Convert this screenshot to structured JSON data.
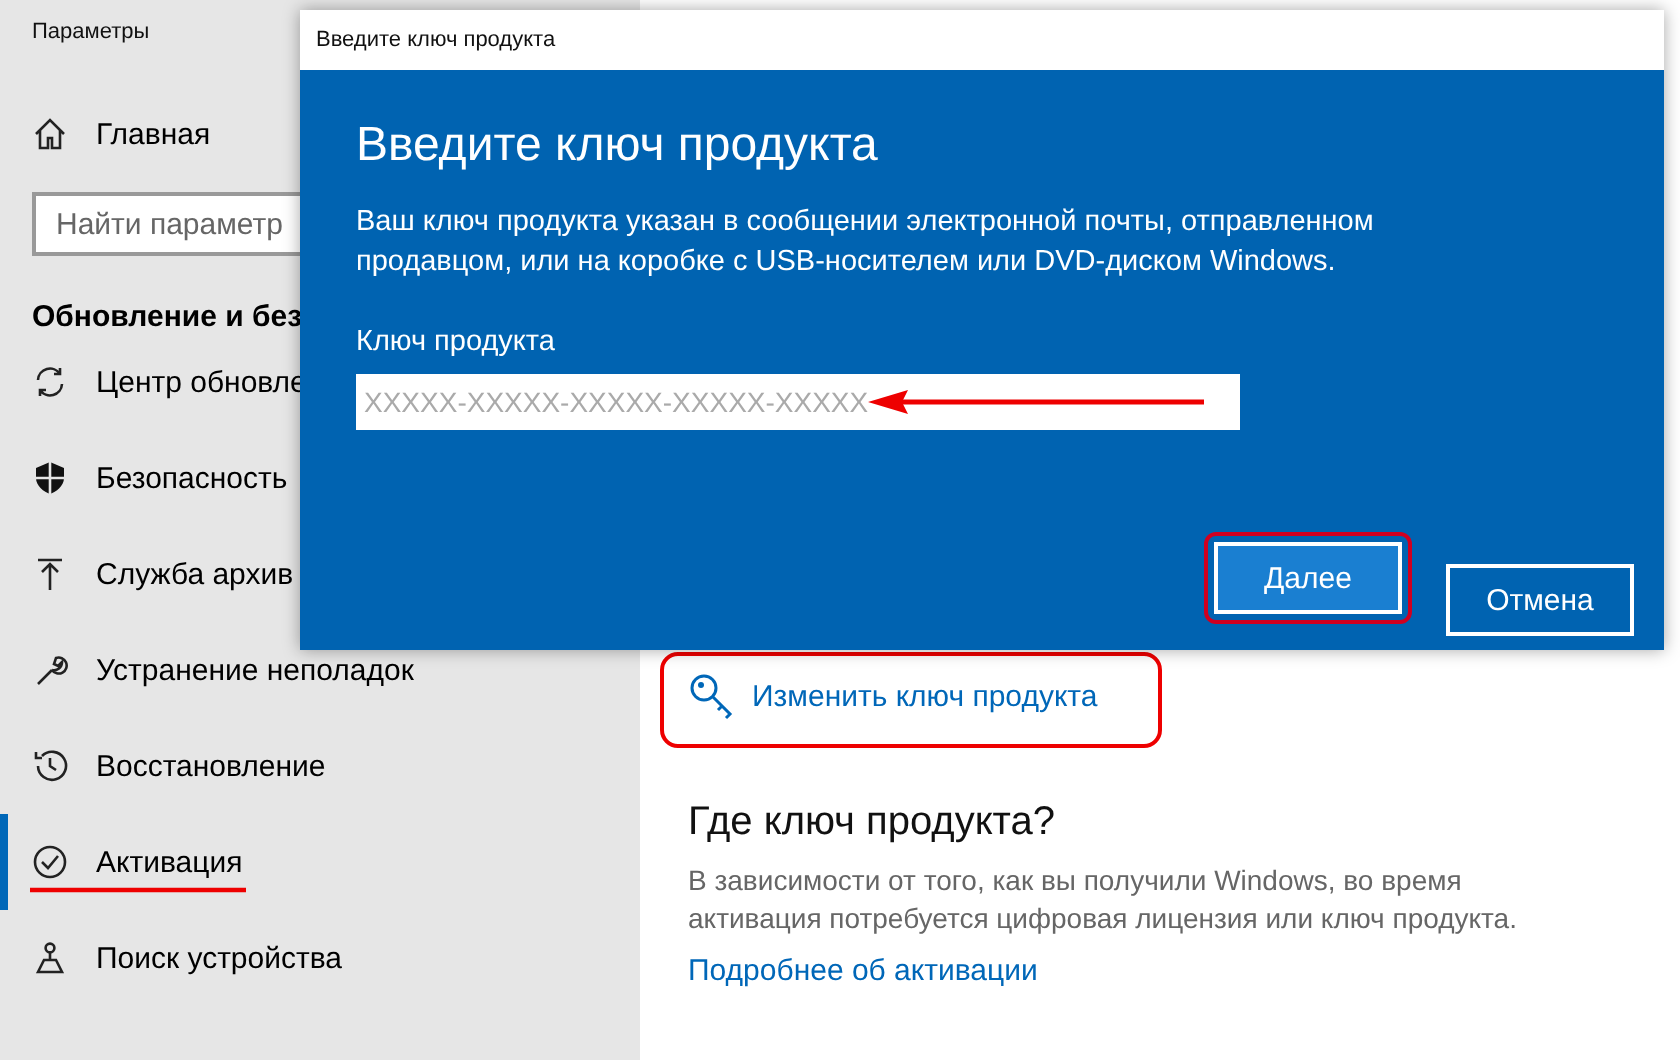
{
  "window": {
    "title": "Параметры"
  },
  "home": {
    "label": "Главная"
  },
  "search": {
    "placeholder": "Найти параметр"
  },
  "section_title": "Обновление и без",
  "sidebar": {
    "items": [
      {
        "kind": "sync",
        "label": "Центр обновле",
        "selected": false
      },
      {
        "kind": "shield",
        "label": "Безопасность",
        "selected": false
      },
      {
        "kind": "upload",
        "label": "Служба архив",
        "selected": false
      },
      {
        "kind": "wrench",
        "label": "Устранение неполадок",
        "selected": false
      },
      {
        "kind": "history",
        "label": "Восстановление",
        "selected": false
      },
      {
        "kind": "check",
        "label": "Активация",
        "selected": true
      },
      {
        "kind": "find",
        "label": "Поиск устройства",
        "selected": false
      }
    ]
  },
  "content": {
    "change_key_link": "Изменить ключ продукта",
    "heading": "Где ключ продукта?",
    "text": "В зависимости от того, как вы получили Windows, во время активация потребуется цифровая лицензия или ключ продукта.",
    "more_link": "Подробнее об активации"
  },
  "dialog": {
    "title": "Введите ключ продукта",
    "heading": "Введите ключ продукта",
    "text": "Ваш ключ продукта указан в сообщении электронной почты, отправленном продавцом, или на коробке с USB-носителем или DVD-диском Windows.",
    "field_label": "Ключ продукта",
    "field": {
      "placeholder": "XXXXX-XXXXX-XXXXX-XXXXX-XXXXX"
    },
    "buttons": [
      {
        "label": "Далее",
        "kind": "primary"
      },
      {
        "label": "Отмена",
        "kind": "secondary"
      }
    ]
  }
}
